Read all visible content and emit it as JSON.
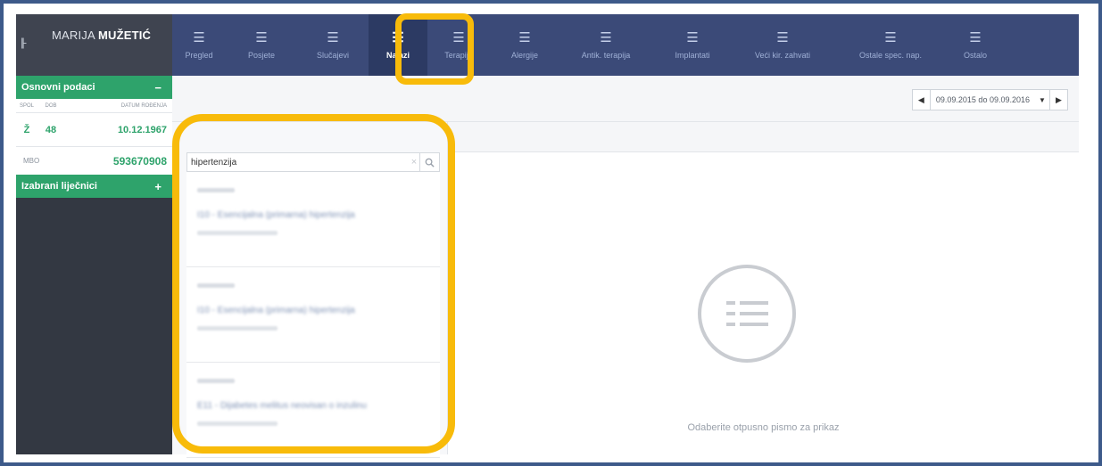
{
  "patient": {
    "first_name": "MARIJA",
    "last_name": "MUŽETIĆ",
    "collapse_glyph": "||-"
  },
  "basic_info": {
    "title": "Osnovni podaci",
    "toggle": "−",
    "columns": [
      "SPOL",
      "DOB",
      "DATUM ROĐENJA"
    ],
    "values": [
      "Ž",
      "48",
      "10.12.1967"
    ],
    "mbo_label": "MBO",
    "mbo_value": "593670908"
  },
  "doctors": {
    "title": "Izabrani liječnici",
    "toggle": "+"
  },
  "nav": {
    "tabs": [
      {
        "label": "Pregled",
        "icon": "list-icon"
      },
      {
        "label": "Posjete",
        "icon": "list-icon"
      },
      {
        "label": "Slučajevi",
        "icon": "list-icon"
      },
      {
        "label": "Nalazi",
        "icon": "list-icon",
        "active": true
      },
      {
        "label": "Terapija",
        "icon": "list-icon"
      },
      {
        "label": "Alergije",
        "icon": "list-icon"
      },
      {
        "label": "Antik. terapija",
        "icon": "list-icon"
      },
      {
        "label": "Implantati",
        "icon": "list-icon"
      },
      {
        "label": "Veći kir. zahvati",
        "icon": "list-icon"
      },
      {
        "label": "Ostale spec. nap.",
        "icon": "list-icon"
      },
      {
        "label": "Ostalo",
        "icon": "list-icon"
      }
    ]
  },
  "date_range": {
    "prev": "◀",
    "text": "09.09.2015 do 09.09.2016",
    "caret": "▼",
    "next": "▶"
  },
  "search": {
    "value": "hipertenzija",
    "clear": "×",
    "button_icon": "search-icon"
  },
  "results": [
    {
      "title": "I10 - Esencijalna (primarna) hipertenzija"
    },
    {
      "title": "I10 - Esencijalna (primarna) hipertenzija"
    },
    {
      "title": "E11 - Dijabetes melitus neovisan o inzulinu"
    }
  ],
  "empty_state": {
    "text": "Odaberite otpusno pismo za prikaz",
    "icon": "list-icon"
  },
  "colors": {
    "highlight": "#f8bb0a",
    "nav": "#3b4a78",
    "accent_green": "#2ea36b"
  }
}
